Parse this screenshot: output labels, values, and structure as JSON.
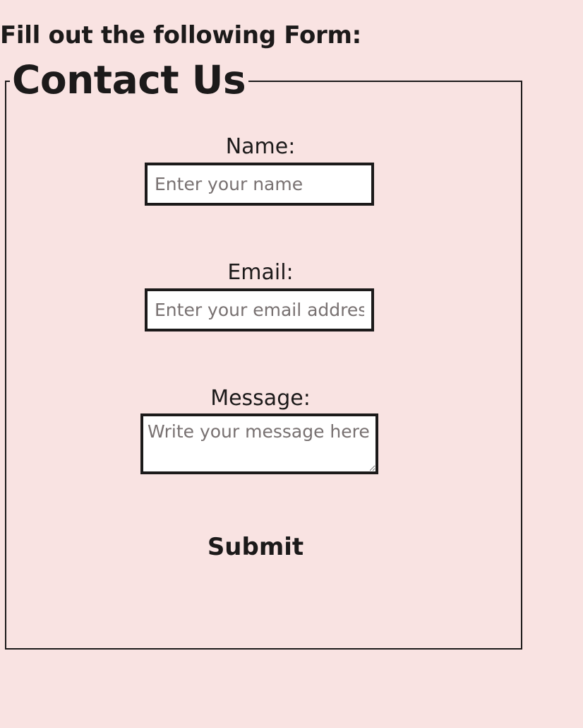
{
  "page": {
    "heading": "Fill out the following Form:"
  },
  "form": {
    "legend": "Contact Us",
    "name": {
      "label": "Name:",
      "placeholder": "Enter your name",
      "value": ""
    },
    "email": {
      "label": "Email:",
      "placeholder": "Enter your email address",
      "value": ""
    },
    "message": {
      "label": "Message:",
      "placeholder": "Write your message here",
      "value": ""
    },
    "submit_label": "Submit"
  },
  "colors": {
    "background": "#f9e3e2",
    "text": "#1c1a1a",
    "input_background": "#ffffff",
    "placeholder": "#787171"
  }
}
